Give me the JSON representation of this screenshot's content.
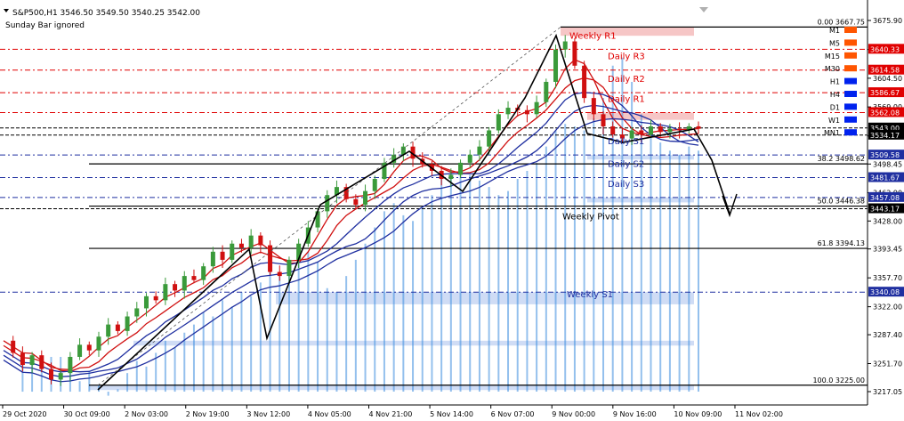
{
  "header": {
    "symbol_line": "S&P500,H1  3546.50 3549.50 3540.25 3542.00",
    "note": "Sunday Bar ignored"
  },
  "chart_data": {
    "type": "candlestick",
    "symbol": "S&P500",
    "timeframe": "H1",
    "last_bar": {
      "open": 3546.5,
      "high": 3549.5,
      "low": 3540.25,
      "close": 3542.0
    },
    "ylim": [
      3210,
      3685
    ],
    "y_ticks": [
      "3675.90",
      "3640.05",
      "3604.50",
      "3569.00",
      "3533.15",
      "3498.45",
      "3462.90",
      "3428.00",
      "3393.45",
      "3357.70",
      "3322.00",
      "3287.40",
      "3251.70",
      "3217.05"
    ],
    "x_ticks": [
      "29 Oct 2020",
      "30 Oct 09:00",
      "2 Nov 03:00",
      "2 Nov 19:00",
      "3 Nov 12:00",
      "4 Nov 05:00",
      "4 Nov 21:00",
      "5 Nov 14:00",
      "6 Nov 07:00",
      "9 Nov 00:00",
      "9 Nov 16:00",
      "10 Nov 09:00",
      "11 Nov 02:00"
    ],
    "price_tags": [
      {
        "value": 3640.33,
        "label": "3640.33",
        "color": "#e00000"
      },
      {
        "value": 3614.58,
        "label": "3614.58",
        "color": "#e00000"
      },
      {
        "value": 3586.67,
        "label": "3586.67",
        "color": "#e00000"
      },
      {
        "value": 3562.08,
        "label": "3562.08",
        "color": "#e00000"
      },
      {
        "value": 3543.0,
        "label": "3543.00",
        "color": "#000000"
      },
      {
        "value": 3534.17,
        "label": "3534.17",
        "color": "#000000"
      },
      {
        "value": 3509.58,
        "label": "3509.58",
        "color": "#1f2fa0"
      },
      {
        "value": 3481.67,
        "label": "3481.67",
        "color": "#1f2fa0"
      },
      {
        "value": 3457.08,
        "label": "3457.08",
        "color": "#1f2fa0"
      },
      {
        "value": 3443.17,
        "label": "3443.17",
        "color": "#000000"
      },
      {
        "value": 3340.08,
        "label": "3340.08",
        "color": "#1f2fa0"
      }
    ],
    "fibonacci": [
      {
        "level": "0.00",
        "value": 3667.75,
        "label": "0.00  3667.75"
      },
      {
        "level": "38.2",
        "value": 3498.62,
        "label": "38.2   3498.62"
      },
      {
        "level": "50.0",
        "value": 3446.38,
        "label": "50.0   3446.38"
      },
      {
        "level": "61.8",
        "value": 3394.13,
        "label": "61.8   3394.13"
      },
      {
        "level": "100.0",
        "value": 3225.0,
        "label": "100.0   3225.00"
      }
    ],
    "pivot_labels": [
      {
        "text": "Weekly R1",
        "value": 3640.33,
        "color": "#e00000"
      },
      {
        "text": "Daily R3",
        "value": 3614.58,
        "color": "#e00000"
      },
      {
        "text": "Daily R2",
        "value": 3586.67,
        "color": "#e00000"
      },
      {
        "text": "Daily R1",
        "value": 3562.08,
        "color": "#e00000"
      },
      {
        "text": "Daily S1",
        "value": 3509.58,
        "color": "#1f2fa0"
      },
      {
        "text": "Daily S2",
        "value": 3481.67,
        "color": "#1f2fa0"
      },
      {
        "text": "Daily S3",
        "value": 3457.08,
        "color": "#1f2fa0"
      },
      {
        "text": "Weekly Pivot",
        "value": 3443.17,
        "color": "#000000"
      },
      {
        "text": "Weekly S1",
        "value": 3340.08,
        "color": "#1f2fa0"
      }
    ],
    "timeframe_legend": [
      {
        "label": "M1",
        "color": "#ff5500"
      },
      {
        "label": "M5",
        "color": "#ff5500"
      },
      {
        "label": "M15",
        "color": "#ff5500"
      },
      {
        "label": "M30",
        "color": "#ff5500"
      },
      {
        "label": "H1",
        "color": "#0022ee"
      },
      {
        "label": "H4",
        "color": "#0022ee"
      },
      {
        "label": "D1",
        "color": "#0022ee"
      },
      {
        "label": "W1",
        "color": "#0022ee"
      },
      {
        "label": "MN1",
        "color": "#0022ee"
      }
    ],
    "close_path": [
      3280,
      3265,
      3250,
      3262,
      3245,
      3232,
      3240,
      3260,
      3275,
      3268,
      3285,
      3300,
      3292,
      3310,
      3320,
      3335,
      3330,
      3350,
      3342,
      3360,
      3355,
      3372,
      3390,
      3380,
      3400,
      3395,
      3410,
      3398,
      3365,
      3360,
      3380,
      3400,
      3420,
      3440,
      3460,
      3470,
      3455,
      3448,
      3465,
      3480,
      3500,
      3510,
      3520,
      3505,
      3498,
      3490,
      3480,
      3485,
      3500,
      3510,
      3520,
      3540,
      3560,
      3568,
      3565,
      3560,
      3575,
      3600,
      3640,
      3650,
      3620,
      3580,
      3560,
      3545,
      3535,
      3530,
      3540,
      3535,
      3545,
      3538,
      3542,
      3540,
      3545,
      3542
    ],
    "colors": {
      "bull": "#3a9a3a",
      "bear": "#d01010",
      "resistance": "#e00000",
      "support": "#1f2fa0",
      "ribbon": "#3d8ee0"
    }
  }
}
